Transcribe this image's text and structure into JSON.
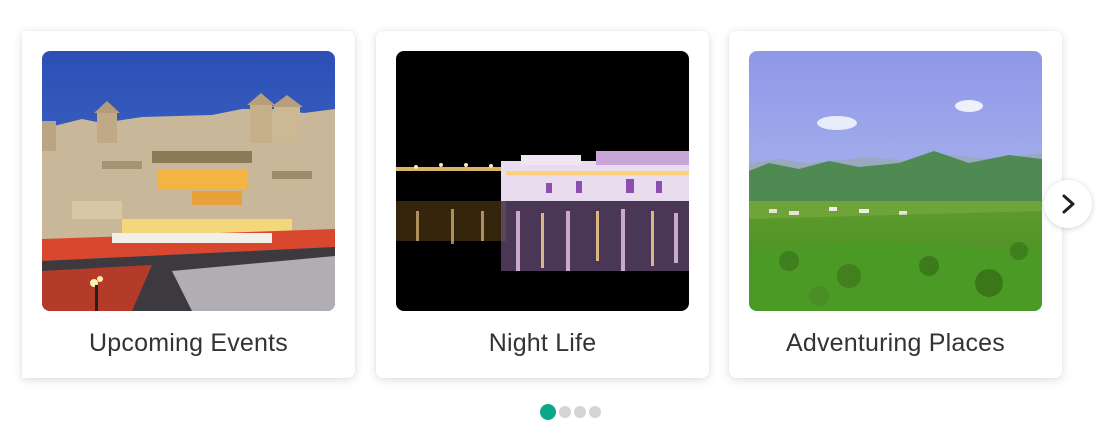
{
  "carousel": {
    "cards": [
      {
        "label": "Upcoming Events",
        "image": "city-palace-evening-photo"
      },
      {
        "label": "Night Life",
        "image": "lake-palace-night-photo"
      },
      {
        "label": "Adventuring Places",
        "image": "green-hills-landscape-photo"
      }
    ],
    "next_icon": "chevron-right-icon",
    "pagination": {
      "count": 4,
      "active_index": 0
    },
    "colors": {
      "accent": "#0aa886",
      "inactive_dot": "#d4d4d4",
      "label_text": "#333333"
    }
  }
}
